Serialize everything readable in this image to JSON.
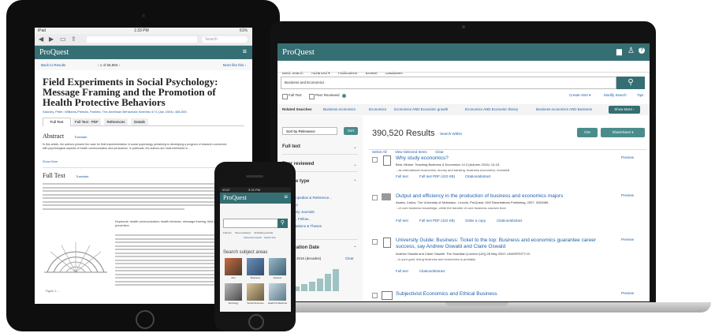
{
  "laptop": {
    "logo": "ProQuest",
    "header_icons": [
      "folder-icon",
      "user-icon",
      "help-icon"
    ],
    "nav": [
      "Basic Search",
      "Advanced ▾",
      "Publications",
      "Browse",
      "Databases"
    ],
    "search_value": "Business and Economics",
    "fulltext_label": "Full Text",
    "peer_label": "Peer Reviewed",
    "create_alert": "Create Alert ▾",
    "modify_search": "Modify Search",
    "tips": "Tips",
    "related_label": "Related Searches",
    "related": [
      "Business economics",
      "Economics",
      "Economics AND Economic growth",
      "Economics AND Economic theory",
      "Business economics AND Business"
    ],
    "show_more": "Show More ›",
    "sort_label": "Sort by Relevance",
    "sort_button": "Sort",
    "results_count": "390,520 Results",
    "search_within": "Search Within",
    "select_all": "Select All",
    "view_selected": "View Selected Items",
    "clear": "Clear",
    "cite": "Cite",
    "share_save": "Share/Save ▾",
    "facets": [
      "Full text",
      "Peer reviewed",
      "Source type",
      "Publication Date"
    ],
    "source_items": [
      "Books",
      "Encyclopedias & Reference...",
      "Reports",
      "Scholarly Journals",
      "Grants, Fellow...",
      "Dissertations & Theses"
    ],
    "date_range": "1956 - 2016 (decades)",
    "clear_btn": "Clear",
    "preview": "Preview",
    "results": [
      {
        "title": "Why study economics?",
        "meta": "Best, Miriam. Teaching Business & Economics 14.3 (Autumn 2010): 14-15.",
        "snippet": "...as international economics, money and banking, business economics, industrial",
        "links": [
          "Full text",
          "Full text PDF (422 KB)",
          "Citation/abstract"
        ]
      },
      {
        "title": "Output and efficiency in the production of business and economics majors",
        "meta": "Asarta, Carlos. The University of Nebraska - Lincoln, ProQuest, UMI Dissertations Publishing, 2007. 3283485.",
        "snippet": "...of core business knowledge, while the transfer of core business courses from",
        "links": [
          "Full text",
          "Full text PDF (422 KB)",
          "Order a copy",
          "Citation/abstract"
        ]
      },
      {
        "title": "University Guide: Business: Ticket to the top: Business and economics guarantee career success, say Andrew Oswald and Claire Oswald",
        "meta": "Andrew Oswald and Claire Oswald. The Guardian [London (UK)] 28 May 2002: UNIVERSITY.10.",
        "snippet": "...is your goal, doing business and economics is probably",
        "links": [
          "Full text",
          "Citation/abstract"
        ]
      },
      {
        "title": "Subjectivist Economics and Ethical Business",
        "meta": "",
        "snippet": "",
        "links": []
      }
    ]
  },
  "tablet": {
    "status_left": "iPad",
    "status_time": "1:33 PM",
    "status_right": "61%",
    "search_placeholder": "Search",
    "logo": "ProQuest",
    "back": "Back to Results",
    "pager": "‹  1 of 58,893  ›",
    "more_like": "More like this ›",
    "title": "Field Experiments in Social Psychology: Message Framing and the Promotion of Health Protective Behaviors",
    "authors": "Salovey, Peter; Williams-Piehota, Pamela. The American Behavioral Scientist 47.5 (Jan 2004): 488-505.",
    "tabs": [
      "Full Text",
      "Full Text - PDF",
      "References",
      "Details"
    ],
    "abstract_h": "Abstract",
    "translate": "Translate",
    "abstract_text": "In this article, the authors present the case for field experimentation in social psychology pertaining to developing a program of research concerned with psychological aspects of health communication and persuasion. In particular, the authors are most interested in...",
    "show_more": "Show More",
    "fulltext_h": "Full Text",
    "keywords": "Keywords: health communication; health behavior; message framing; field experiments; cancer prevention",
    "caption": "Figure 1: ..."
  },
  "phone": {
    "status_left": "AT&T",
    "status_time": "3:33 PM",
    "logo": "ProQuest",
    "options": [
      "Full text",
      "Peer reviewed",
      "Scholarly journals"
    ],
    "adv": "Advanced search · Search tips",
    "subject_heading": "Search subject areas",
    "subjects": [
      "Arts",
      "Business",
      "Science",
      "Sociology",
      "Social Sciences",
      "Health & Medicine"
    ]
  }
}
